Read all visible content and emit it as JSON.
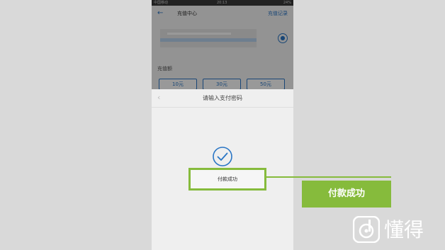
{
  "status_bar": {
    "left": "中国移动",
    "time": "20:13",
    "right": "24%"
  },
  "background_app": {
    "title": "充值中心",
    "record_link": "充值记录",
    "charge_label": "充值额",
    "amounts": [
      "10元",
      "30元",
      "50元"
    ]
  },
  "payment_sheet": {
    "title": "请输入支付密码",
    "success_text": "付款成功"
  },
  "callout": {
    "text": "付款成功"
  },
  "brand": {
    "name": "懂得"
  },
  "colors": {
    "accent_green": "#86bb3c",
    "link_blue": "#2a76c5"
  }
}
